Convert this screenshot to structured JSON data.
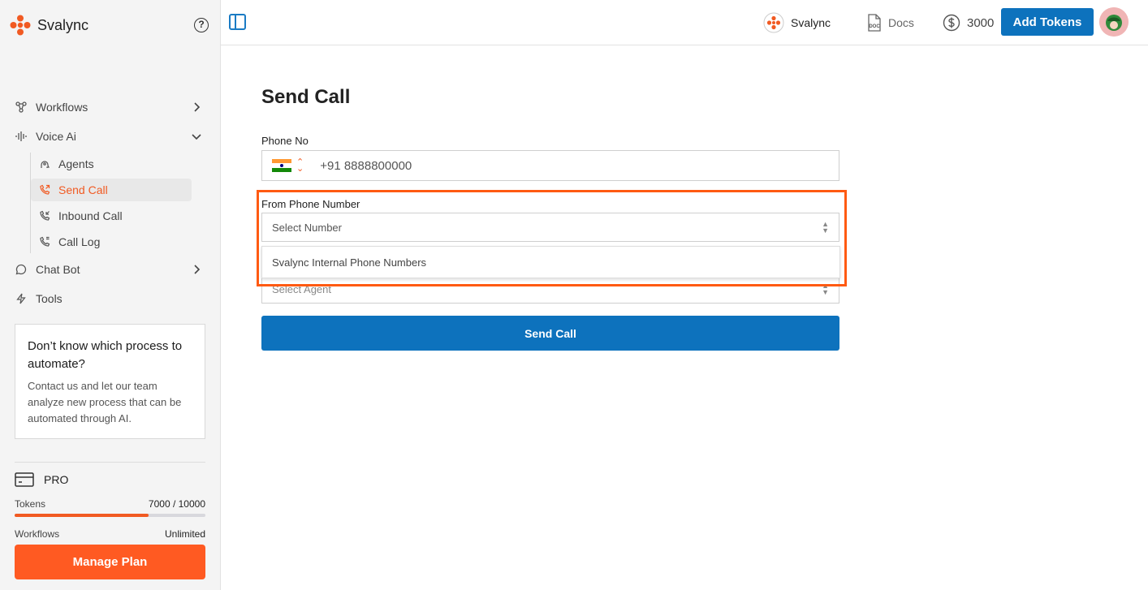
{
  "brand": {
    "name": "Svalync",
    "accent": "#f15a22"
  },
  "sidebar": {
    "help_icon": "?",
    "nav": [
      {
        "label": "Workflows",
        "icon": "workflow-icon"
      },
      {
        "label": "Voice Ai",
        "icon": "waveform-icon"
      },
      {
        "label": "Chat Bot",
        "icon": "chat-icon"
      },
      {
        "label": "Tools",
        "icon": "bolt-icon"
      }
    ],
    "voice_sub": [
      {
        "label": "Agents",
        "icon": "agent-icon"
      },
      {
        "label": "Send Call",
        "icon": "phone-outgoing-icon",
        "active": true
      },
      {
        "label": "Inbound Call",
        "icon": "phone-incoming-icon"
      },
      {
        "label": "Call Log",
        "icon": "phone-log-icon"
      }
    ],
    "promo": {
      "title": "Don’t know which process to automate?",
      "text": "Contact us and let our team analyze new process that can be automated through AI."
    },
    "plan": {
      "name": "PRO",
      "tokens_label": "Tokens",
      "tokens_value": "7000 / 10000",
      "tokens_fraction": 0.7,
      "workflows_label": "Workflows",
      "workflows_value": "Unlimited",
      "manage_label": "Manage Plan"
    }
  },
  "topbar": {
    "workspace": "Svalync",
    "docs_label": "Docs",
    "doc_icon_text": "DOC",
    "token_balance": "3000",
    "add_tokens_label": "Add Tokens"
  },
  "main": {
    "title": "Send Call",
    "phone_label": "Phone No",
    "phone_value": "+91 8888800000",
    "from_label": "From Phone Number",
    "from_placeholder": "Select Number",
    "dropdown_option": "Svalync Internal Phone Numbers",
    "agent_placeholder": "Select Agent",
    "send_label": "Send Call"
  }
}
